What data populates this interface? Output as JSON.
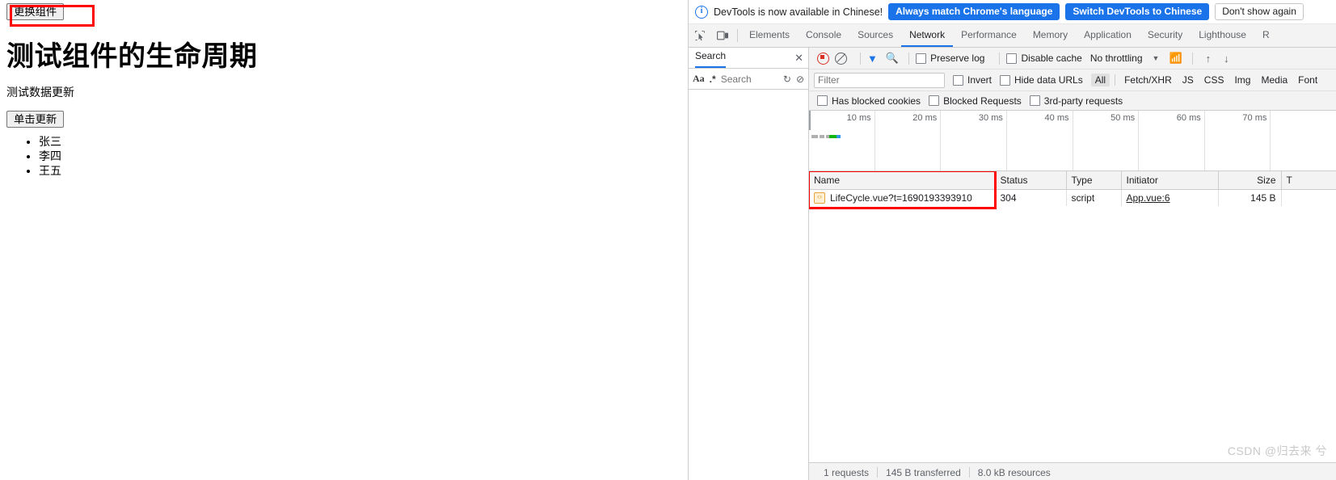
{
  "page": {
    "swap_button": "更换组件",
    "title": "测试组件的生命周期",
    "subtitle": "测试数据更新",
    "update_button": "单击更新",
    "list": [
      "张三",
      "李四",
      "王五"
    ]
  },
  "devtools": {
    "banner": {
      "icon": "info-icon",
      "message": "DevTools is now available in Chinese!",
      "primary_button": "Always match Chrome's language",
      "secondary_button": "Switch DevTools to Chinese",
      "dismiss_button": "Don't show again"
    },
    "tabs": [
      {
        "label": "Elements",
        "active": false
      },
      {
        "label": "Console",
        "active": false
      },
      {
        "label": "Sources",
        "active": false
      },
      {
        "label": "Network",
        "active": true
      },
      {
        "label": "Performance",
        "active": false
      },
      {
        "label": "Memory",
        "active": false
      },
      {
        "label": "Application",
        "active": false
      },
      {
        "label": "Security",
        "active": false
      },
      {
        "label": "Lighthouse",
        "active": false
      },
      {
        "label": "R",
        "active": false
      }
    ],
    "search_panel": {
      "tab_label": "Search",
      "close_icon": "close-icon",
      "match_case_icon": "Aa",
      "regex_icon": ".*",
      "input_placeholder": "Search",
      "refresh_icon": "refresh-icon",
      "clear_icon": "clear-icon"
    },
    "network_toolbar": {
      "record_icon": "record-icon",
      "clear_icon": "clear-icon",
      "filter_icon": "filter-icon",
      "search_icon": "search-icon",
      "preserve_log": "Preserve log",
      "disable_cache": "Disable cache",
      "throttling": "No throttling",
      "throttle_caret": "chevron-down-icon",
      "network_conditions_icon": "wifi-settings-icon",
      "import_icon": "upload-icon",
      "export_icon": "download-icon"
    },
    "filter_row": {
      "filter_placeholder": "Filter",
      "invert": "Invert",
      "hide_data_urls": "Hide data URLs",
      "types": [
        "All",
        "Fetch/XHR",
        "JS",
        "CSS",
        "Img",
        "Media",
        "Font"
      ],
      "selected_type": "All"
    },
    "checkbox_row": {
      "has_blocked_cookies": "Has blocked cookies",
      "blocked_requests": "Blocked Requests",
      "third_party_requests": "3rd-party requests"
    },
    "overview": {
      "ticks": [
        "10 ms",
        "20 ms",
        "30 ms",
        "40 ms",
        "50 ms",
        "60 ms",
        "70 ms"
      ],
      "bar_segments": [
        {
          "color": "#b0b0b0",
          "width": 8
        },
        {
          "color": "#ffffff",
          "width": 2
        },
        {
          "color": "#b0b0b0",
          "width": 6
        },
        {
          "color": "#ffffff",
          "width": 2
        },
        {
          "color": "#b0b0b0",
          "width": 4
        },
        {
          "color": "#0fb40f",
          "width": 9
        },
        {
          "color": "#3596f0",
          "width": 5
        }
      ]
    },
    "table": {
      "headers": [
        "Name",
        "Status",
        "Type",
        "Initiator",
        "Size",
        "T"
      ],
      "rows": [
        {
          "icon": "js-script-icon",
          "name": "LifeCycle.vue?t=1690193393910",
          "status": "304",
          "type": "script",
          "initiator": "App.vue:6",
          "size": "145 B",
          "time": ""
        }
      ]
    },
    "status_bar": {
      "requests": "1 requests",
      "transferred": "145 B transferred",
      "resources": "8.0 kB resources"
    },
    "watermark": "CSDN @归去来 兮"
  },
  "annotations": {
    "accent_color": "#fe0000",
    "swap_button_box": "highlight around 更换组件 button",
    "table_box": "highlight around Name column header and request row"
  }
}
